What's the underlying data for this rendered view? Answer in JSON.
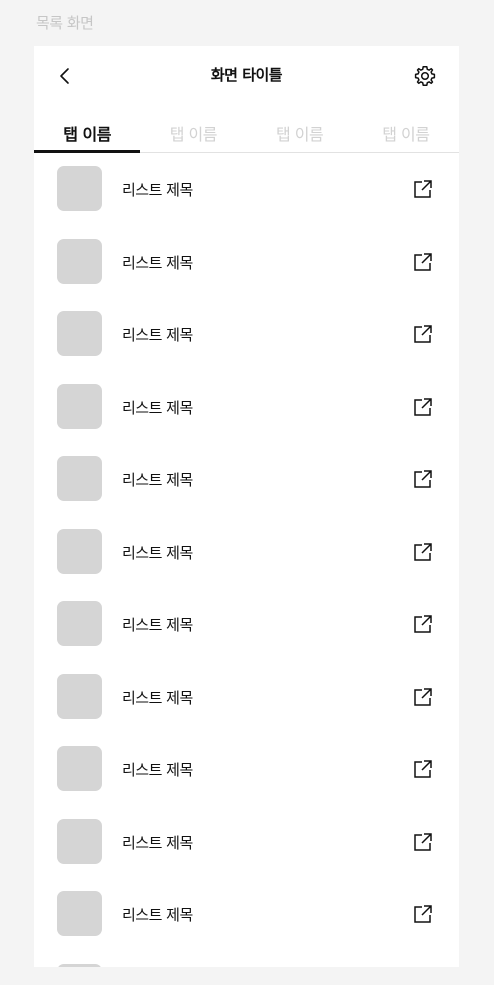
{
  "canvas_label": "목록 화면",
  "header": {
    "title": "화면 타이틀",
    "back_icon": "chevron-left-icon",
    "settings_icon": "gear-icon"
  },
  "tabs": [
    {
      "label": "탭 이름",
      "active": true
    },
    {
      "label": "탭 이름",
      "active": false
    },
    {
      "label": "탭 이름",
      "active": false
    },
    {
      "label": "탭 이름",
      "active": false
    }
  ],
  "list": {
    "items": [
      {
        "title": "리스트 제목"
      },
      {
        "title": "리스트 제목"
      },
      {
        "title": "리스트 제목"
      },
      {
        "title": "리스트 제목"
      },
      {
        "title": "리스트 제목"
      },
      {
        "title": "리스트 제목"
      },
      {
        "title": "리스트 제목"
      },
      {
        "title": "리스트 제목"
      },
      {
        "title": "리스트 제목"
      },
      {
        "title": "리스트 제목"
      },
      {
        "title": "리스트 제목"
      }
    ],
    "item_icon": "external-link-icon"
  },
  "colors": {
    "background": "#f4f4f4",
    "surface": "#ffffff",
    "text": "#111111",
    "inactive_tab": "#d2d2d2",
    "thumbnail": "#d5d5d5"
  }
}
